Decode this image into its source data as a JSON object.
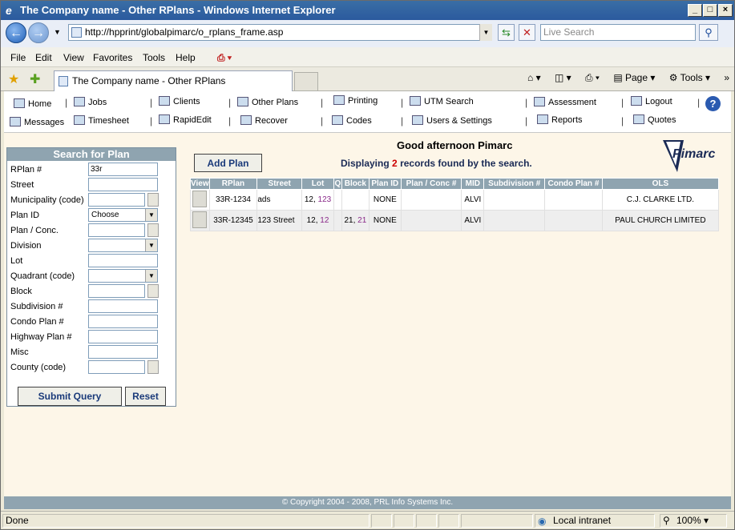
{
  "window": {
    "title": "The Company name - Other RPlans - Windows Internet Explorer"
  },
  "address": {
    "url": "http://hpprint/globalpimarc/o_rplans_frame.asp",
    "search_placeholder": "Live Search"
  },
  "menu": [
    "File",
    "Edit",
    "View",
    "Favorites",
    "Tools",
    "Help"
  ],
  "tab": {
    "label": "The Company name - Other RPlans"
  },
  "cmdbar": {
    "page": "Page",
    "tools": "Tools"
  },
  "nav": {
    "home": "Home",
    "jobs": "Jobs",
    "clients": "Clients",
    "other_plans": "Other Plans",
    "printing": "Printing",
    "utm_search": "UTM Search",
    "assessment": "Assessment",
    "logout": "Logout",
    "messages": "Messages",
    "timesheet": "Timesheet",
    "rapidedit": "RapidEdit",
    "recover": "Recover",
    "codes": "Codes",
    "users_settings": "Users & Settings",
    "reports": "Reports",
    "quotes": "Quotes"
  },
  "search_panel": {
    "title": "Search for Plan",
    "fields": {
      "rplan": "RPlan #",
      "street": "Street",
      "municipality": "Municipality (code)",
      "plan_id": "Plan ID",
      "plan_conc": "Plan / Conc.",
      "division": "Division",
      "lot": "Lot",
      "quadrant": "Quadrant (code)",
      "block": "Block",
      "subdivision": "Subdivision #",
      "condo_plan": "Condo Plan #",
      "highway_plan": "Highway Plan #",
      "misc": "Misc",
      "county": "County (code)"
    },
    "rplan_value": "33r",
    "plan_id_value": "Choose",
    "submit": "Submit Query",
    "reset": "Reset"
  },
  "main": {
    "add_plan": "Add Plan",
    "greeting": "Good afternoon Pimarc",
    "display_prefix": "Displaying",
    "display_count": "2",
    "display_suffix": "records found by the search.",
    "logo": "Pimarc"
  },
  "table": {
    "headers": [
      "View",
      "RPlan",
      "Street",
      "Lot",
      "Q",
      "Block",
      "Plan ID",
      "Plan / Conc #",
      "MID",
      "Subdivision #",
      "Condo Plan #",
      "OLS"
    ],
    "rows": [
      {
        "rplan": "33R-1234",
        "street": "ads",
        "lot_a": "12,",
        "lot_b": "123",
        "q": "",
        "block_a": "",
        "block_b": "",
        "plan_id": "NONE",
        "plan_conc": "",
        "mid": "ALVI",
        "subdivision": "",
        "condo": "",
        "ols": "C.J. CLARKE LTD."
      },
      {
        "rplan": "33R-12345",
        "street": "123 Street",
        "lot_a": "12,",
        "lot_b": "12",
        "q": "",
        "block_a": "21,",
        "block_b": "21",
        "plan_id": "NONE",
        "plan_conc": "",
        "mid": "ALVI",
        "subdivision": "",
        "condo": "",
        "ols": "PAUL CHURCH LIMITED"
      }
    ]
  },
  "footer": "© Copyright 2004 - 2008, PRL Info Systems Inc.",
  "status": {
    "text": "Done",
    "zone": "Local intranet",
    "zoom": "100%"
  }
}
